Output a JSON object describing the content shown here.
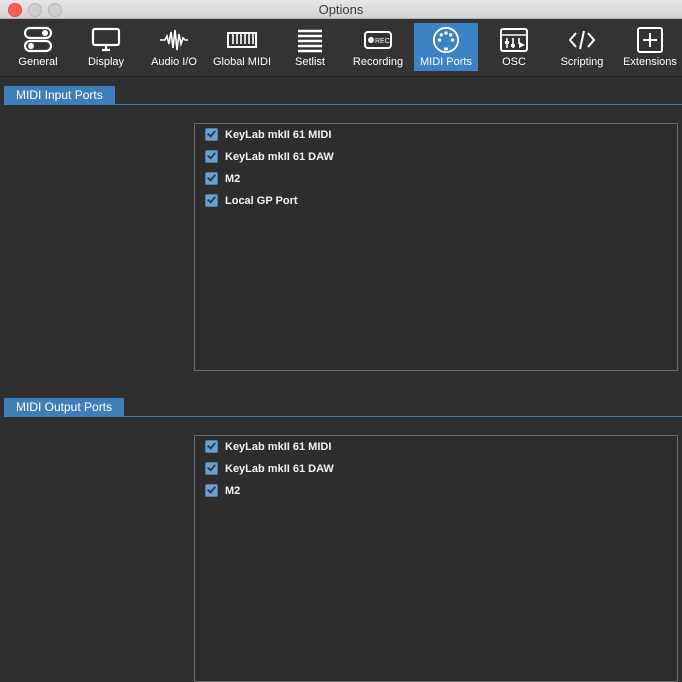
{
  "window": {
    "title": "Options"
  },
  "toolbar": {
    "items": [
      {
        "label": "General",
        "icon": "toggle-icon"
      },
      {
        "label": "Display",
        "icon": "monitor-icon"
      },
      {
        "label": "Audio I/O",
        "icon": "waveform-icon"
      },
      {
        "label": "Global MIDI",
        "icon": "keyboard-icon"
      },
      {
        "label": "Setlist",
        "icon": "list-icon"
      },
      {
        "label": "Recording",
        "icon": "rec-icon",
        "badge": "REC"
      },
      {
        "label": "MIDI Ports",
        "icon": "midi-din-icon",
        "active": true
      },
      {
        "label": "OSC",
        "icon": "osc-icon"
      },
      {
        "label": "Scripting",
        "icon": "code-icon"
      },
      {
        "label": "Extensions",
        "icon": "plus-box-icon"
      }
    ]
  },
  "midi_input": {
    "title": "MIDI Input Ports",
    "ports": [
      {
        "label": "KeyLab mkII 61 MIDI",
        "checked": true
      },
      {
        "label": "KeyLab mkII 61 DAW",
        "checked": true
      },
      {
        "label": "M2",
        "checked": true
      },
      {
        "label": "Local GP Port",
        "checked": true
      }
    ]
  },
  "midi_output": {
    "title": "MIDI Output Ports",
    "ports": [
      {
        "label": "KeyLab mkII 61 MIDI",
        "checked": true
      },
      {
        "label": "KeyLab mkII 61 DAW",
        "checked": true
      },
      {
        "label": "M2",
        "checked": true
      }
    ]
  },
  "colors": {
    "accent": "#3d82c4",
    "background": "#303030",
    "toolbar": "#333333"
  }
}
